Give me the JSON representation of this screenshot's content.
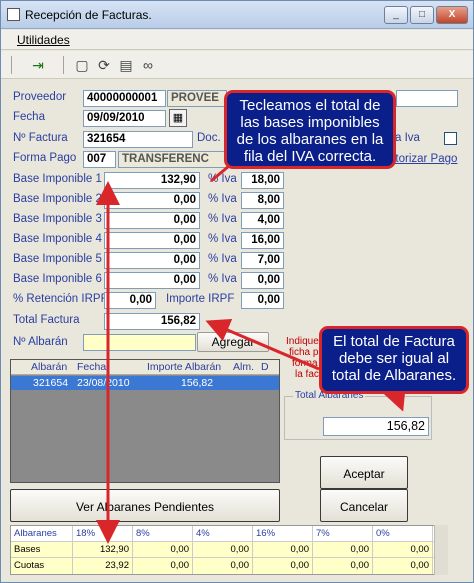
{
  "window": {
    "title": "Recepción de Facturas.",
    "min": "_",
    "max": "□",
    "close": "X"
  },
  "menu": {
    "utilidades": "Utilidades"
  },
  "form": {
    "proveedor_label": "Proveedor",
    "proveedor_code": "40000000001",
    "proveedor_name": "PROVEE",
    "fecha_label": "Fecha",
    "fecha_value": "09/09/2010",
    "factura_label": "Nº Factura",
    "factura_value": "321654",
    "doc_label": "Doc.",
    "iva_label": "a Iva",
    "formapago_label": "Forma Pago",
    "formapago_code": "007",
    "formapago_name": "TRANSFERENC",
    "autorizar_label": "utorizar Pago",
    "bases": [
      {
        "label": "Base Imponible 1",
        "value": "132,90",
        "iva_label": "% Iva",
        "iva": "18,00"
      },
      {
        "label": "Base Imponible 2",
        "value": "0,00",
        "iva_label": "% Iva",
        "iva": "8,00"
      },
      {
        "label": "Base Imponible 3",
        "value": "0,00",
        "iva_label": "% Iva",
        "iva": "4,00"
      },
      {
        "label": "Base Imponible 4",
        "value": "0,00",
        "iva_label": "% Iva",
        "iva": "16,00"
      },
      {
        "label": "Base Imponible 5",
        "value": "0,00",
        "iva_label": "% Iva",
        "iva": "7,00"
      },
      {
        "label": "Base Imponible 6",
        "value": "0,00",
        "iva_label": "% Iva",
        "iva": "0,00"
      }
    ],
    "retencion_label": "% Retención IRPF",
    "retencion_value": "0,00",
    "irpf_label": "Importe IRPF",
    "irpf_value": "0,00",
    "total_label": "Total Factura",
    "total_value": "156,82",
    "albaran_label": "Nº Albarán",
    "albaran_value": "",
    "agregar": "Agregar",
    "indique_lines": [
      "Indique",
      "ficha p",
      "forma de",
      "la fact"
    ]
  },
  "grid": {
    "headers": [
      "Albarán",
      "Fecha",
      "Importe Albarán",
      "Alm.",
      "D"
    ],
    "row": [
      "321654",
      "23/08/2010",
      "156,82",
      "",
      ""
    ]
  },
  "total_albaranes": {
    "label": "Total Albaranes",
    "value": "156,82"
  },
  "buttons": {
    "ver": "Ver Albaranes Pendientes",
    "aceptar": "Aceptar",
    "cancelar": "Cancelar"
  },
  "summary": {
    "headers": [
      "Albaranes",
      "18%",
      "8%",
      "4%",
      "16%",
      "7%",
      "0%"
    ],
    "bases": [
      "Bases",
      "132,90",
      "0,00",
      "0,00",
      "0,00",
      "0,00",
      "0,00"
    ],
    "cuotas": [
      "Cuotas",
      "23,92",
      "0,00",
      "0,00",
      "0,00",
      "0,00",
      "0,00"
    ]
  },
  "callouts": {
    "top": "Tecleamos el total de las bases imponibles de los albaranes en la fila del IVA correcta.",
    "right": "El total de Factura debe ser igual al total de Albaranes."
  },
  "colors": {
    "callout_bg": "#0a1f8a",
    "callout_border": "#d9262a",
    "label": "#2b3fa0",
    "selected_row": "#3b78d4",
    "summary_bg": "#ffffc8"
  }
}
